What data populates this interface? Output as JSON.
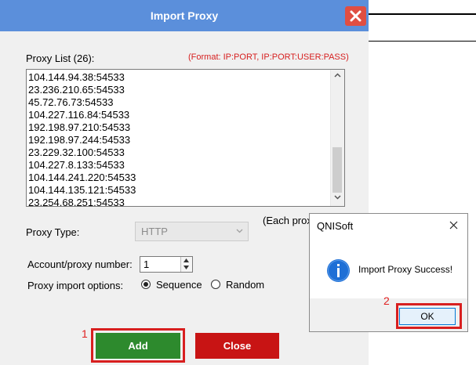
{
  "dialog": {
    "title": "Import Proxy",
    "proxy_list_label": "Proxy List (26):",
    "format_hint": "(Format: IP:PORT, IP:PORT:USER:PASS)",
    "proxies": [
      "104.144.94.38:54533",
      "23.236.210.65:54533",
      "45.72.76.73:54533",
      "104.227.116.84:54533",
      "192.198.97.210:54533",
      "192.198.97.244:54533",
      "23.229.32.100:54533",
      "104.227.8.133:54533",
      "104.144.241.220:54533",
      "104.144.135.121:54533",
      "23.254.68.251:54533"
    ],
    "each_proxy_text": "(Each prox",
    "proxy_type_label": "Proxy Type:",
    "proxy_type_value": "HTTP",
    "account_label": "Account/proxy number:",
    "account_value": "1",
    "import_options_label": "Proxy import options:",
    "option_sequence": "Sequence",
    "option_random": "Random",
    "selected_option": "Sequence",
    "add_label": "Add",
    "close_label": "Close",
    "marker_add": "1"
  },
  "message_box": {
    "title": "QNISoft",
    "message": "Import Proxy Success!",
    "ok_label": "OK",
    "marker_ok": "2"
  },
  "icons": {
    "window_close": "close-icon",
    "info": "info-icon",
    "dropdown": "chevron-down-icon"
  },
  "colors": {
    "title_bar": "#5b8fdb",
    "close_button": "#e04e42",
    "add_button": "#2d8a2d",
    "close_dialog_button": "#c81414",
    "highlight": "#d81f1f",
    "info_icon": "#1e6fd6"
  }
}
